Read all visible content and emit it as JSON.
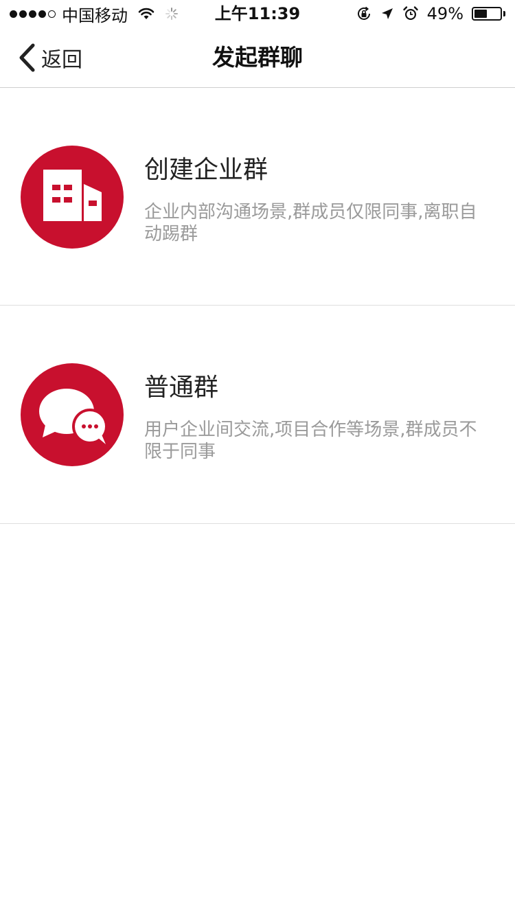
{
  "status_bar": {
    "carrier": "中国移动",
    "time": "上午11:39",
    "battery_percent_label": "49%",
    "battery_level": 0.49,
    "signal_bars_filled": 4,
    "signal_bars_total": 5,
    "icons": [
      "wifi-icon",
      "loading-spinner-icon",
      "rotation-lock-icon",
      "location-arrow-icon",
      "alarm-icon",
      "battery-icon"
    ]
  },
  "nav": {
    "back_label": "返回",
    "title": "发起群聊",
    "back_icon": "chevron-left-icon"
  },
  "options": [
    {
      "title": "创建企业群",
      "description": "企业内部沟通场景,群成员仅限同事,离职自动踢群",
      "icon": "building-icon"
    },
    {
      "title": "普通群",
      "description": "用户企业间交流,项目合作等场景,群成员不限于同事",
      "icon": "chat-bubbles-icon"
    }
  ],
  "colors": {
    "accent": "#c8102e",
    "title_text": "#222222",
    "secondary_text": "#9a9a9a",
    "divider": "#dedede"
  }
}
